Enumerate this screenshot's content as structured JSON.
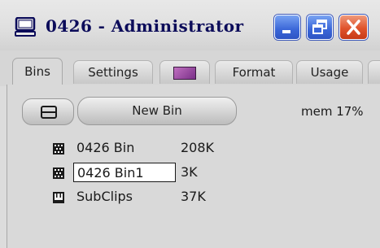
{
  "window": {
    "title": "0426 - Administrator",
    "title_icon": "monitor-icon",
    "controls": [
      "minimize-icon",
      "restore-icon",
      "close-icon"
    ]
  },
  "tabs": [
    {
      "label": "Bins",
      "active": true
    },
    {
      "label": "Settings",
      "active": false
    },
    {
      "label": "",
      "icon": "color-swatch-icon",
      "active": false
    },
    {
      "label": "Format",
      "active": false
    },
    {
      "label": "Usage",
      "active": false
    }
  ],
  "toolbar": {
    "view_toggle_icon": "list-view-icon",
    "new_bin_label": "New Bin",
    "memory": "mem 17%"
  },
  "bins": [
    {
      "name": "0426 Bin",
      "size": "208K",
      "icon": "bin-icon",
      "selected": false
    },
    {
      "name": "0426 Bin1",
      "size": "3K",
      "icon": "bin-icon",
      "selected": true
    },
    {
      "name": "SubClips",
      "size": "37K",
      "icon": "subclip-bin-icon",
      "selected": false
    }
  ],
  "colors": {
    "title_text": "#0c0c5a",
    "control_blue": "#3a66d8",
    "control_red": "#e0532c",
    "panel_bg": "#d9d9d9"
  }
}
